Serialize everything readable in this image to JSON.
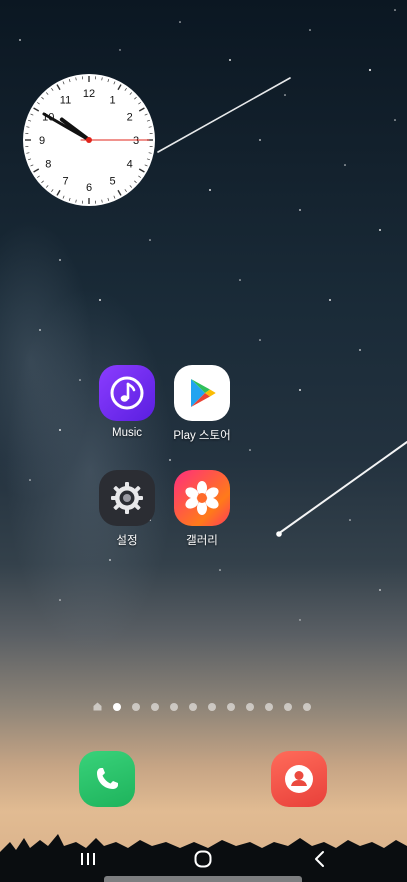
{
  "clock": {
    "numbers": [
      "12",
      "1",
      "2",
      "3",
      "4",
      "5",
      "6",
      "7",
      "8",
      "9",
      "10",
      "11"
    ],
    "hour_hand_time": "10:14",
    "minute_hand_minute": 50,
    "second_hand_second": 15,
    "accent_color": "#e0241b"
  },
  "apps": [
    {
      "label": "Music",
      "icon": "music-note-icon"
    },
    {
      "label": "Play 스토어",
      "icon": "play-store-icon"
    },
    {
      "label": "설정",
      "icon": "settings-gear-icon"
    },
    {
      "label": "갤러리",
      "icon": "gallery-flower-icon"
    }
  ],
  "pager": {
    "page_count": 12,
    "active_index": 1,
    "first_is_home": true
  },
  "dock": [
    {
      "name": "phone",
      "icon": "phone-icon",
      "color": "#22b85f"
    },
    {
      "name": "contacts",
      "icon": "contact-person-icon",
      "color": "#eb4a3f"
    }
  ],
  "navbar": {
    "buttons": [
      "recent-apps-icon",
      "home-icon",
      "back-icon"
    ]
  }
}
